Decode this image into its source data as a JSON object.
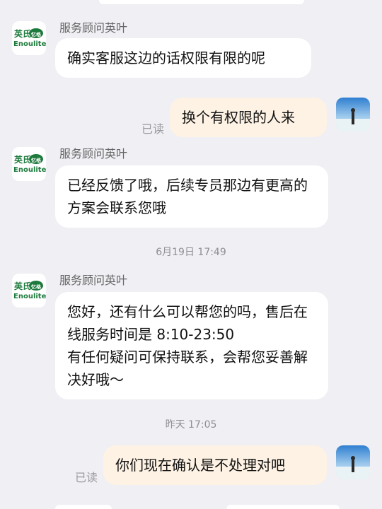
{
  "colors": {
    "background": "#efeff4",
    "incoming_bubble": "#ffffff",
    "outgoing_bubble": "#fdf2e4",
    "brand_green": "#1d7a3c"
  },
  "brand_logo": {
    "text_cn": "英氏",
    "text_badge": "忆格",
    "text_en": "Enoulite"
  },
  "messages": [
    {
      "sender": "服务顾问英叶",
      "text": "确实客服这边的话权限有限的呢"
    },
    {
      "text": "换个有权限的人来",
      "status": "已读"
    },
    {
      "sender": "服务顾问英叶",
      "text": "已经反馈了哦，后续专员那边有更高的方案会联系您哦"
    },
    {
      "timestamp": "6月19日 17:49"
    },
    {
      "sender": "服务顾问英叶",
      "text": "您好，还有什么可以帮您的吗，售后在线服务时间是 8:10-23:50\n有任何疑问可保持联系，会帮您妥善解决好哦～"
    },
    {
      "timestamp": "昨天 17:05"
    },
    {
      "text": "你们现在确认是不处理对吧",
      "status": "已读"
    }
  ]
}
